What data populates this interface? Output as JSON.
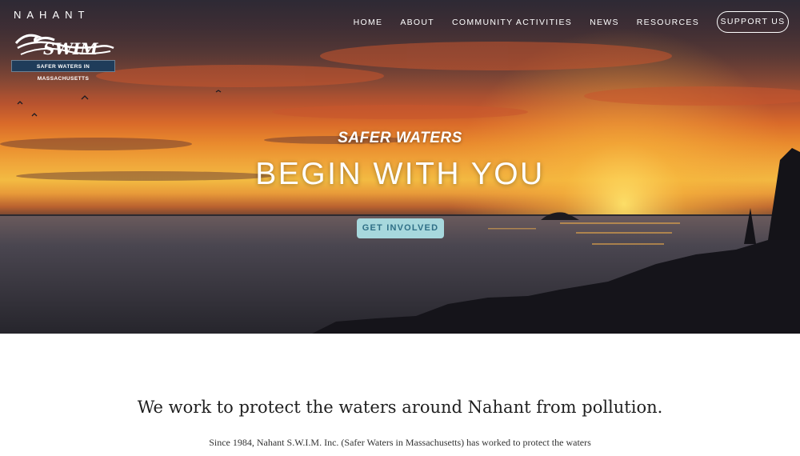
{
  "site": {
    "brand_word": "NAHANT",
    "logo_badge": "SAFER WATERS IN MASSACHUSETTS"
  },
  "nav": {
    "items": [
      {
        "label": "HOME"
      },
      {
        "label": "ABOUT"
      },
      {
        "label": "COMMUNITY ACTIVITIES"
      },
      {
        "label": "NEWS"
      },
      {
        "label": "RESOURCES"
      }
    ],
    "support_label": "SUPPORT US"
  },
  "hero": {
    "tagline": "SAFER WATERS",
    "headline": "BEGIN WITH YOU",
    "cta_label": "GET INVOLVED"
  },
  "content": {
    "heading": "We work to protect the waters around Nahant from pollution.",
    "text": "Since 1984, Nahant S.W.I.M. Inc. (Safer Waters in Massachusetts) has worked to protect the waters"
  },
  "colors": {
    "cta_bg": "#a7d8dd",
    "cta_text": "#2f6f86",
    "badge_bg": "#1f3c5a"
  }
}
